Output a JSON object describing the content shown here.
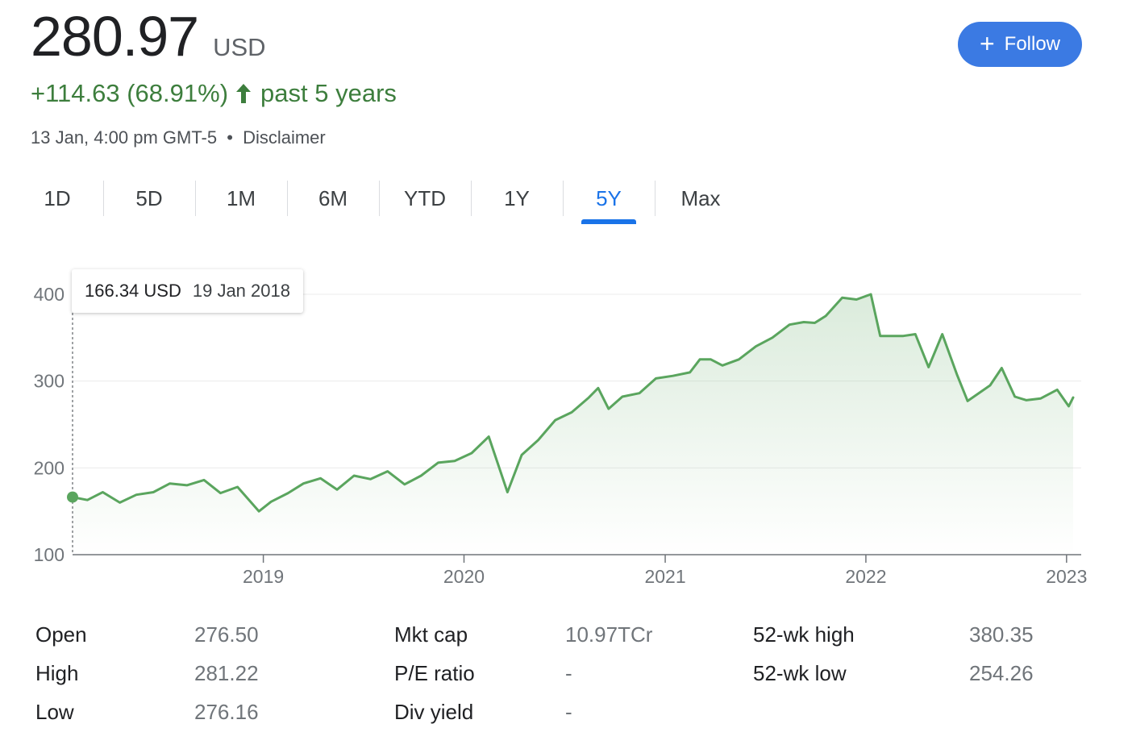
{
  "quote": {
    "price": "280.97",
    "currency": "USD",
    "change": "+114.63 (68.91%)",
    "period": "past 5 years",
    "timestamp": "13 Jan, 4:00 pm GMT-5",
    "separator": "•",
    "disclaimer": "Disclaimer",
    "up_icon": "arrow-up-icon"
  },
  "follow_button": {
    "label": "Follow",
    "icon": "plus-icon"
  },
  "tabs": [
    {
      "label": "1D"
    },
    {
      "label": "5D"
    },
    {
      "label": "1M"
    },
    {
      "label": "6M"
    },
    {
      "label": "YTD"
    },
    {
      "label": "1Y"
    },
    {
      "label": "5Y",
      "active": true
    },
    {
      "label": "Max"
    }
  ],
  "tooltip": {
    "value": "166.34 USD",
    "date": "19 Jan 2018"
  },
  "colors": {
    "line": "#5aa55e",
    "positive": "#3d7e3d",
    "accent": "#1a73e8",
    "button": "#3b7ae3"
  },
  "chart_data": {
    "type": "area",
    "x_unit": "date",
    "xlim": [
      "2018-01-19",
      "2023-01-13"
    ],
    "ylim": [
      100,
      400
    ],
    "yticks": [
      100,
      200,
      300,
      400
    ],
    "ytick_labels": [
      "100",
      "200",
      "300",
      "400"
    ],
    "xticks": [
      "2019-01-01",
      "2020-01-01",
      "2021-01-01",
      "2022-01-01",
      "2023-01-01"
    ],
    "xtick_labels": [
      "2019",
      "2020",
      "2021",
      "2022",
      "2023"
    ],
    "grid": true,
    "highlight_point": {
      "x": "2018-01-19",
      "y": 166.34
    },
    "series": [
      {
        "x": [
          "2018-01-19",
          "2018-02-15",
          "2018-03-15",
          "2018-04-15",
          "2018-05-15",
          "2018-06-15",
          "2018-07-15",
          "2018-08-15",
          "2018-09-15",
          "2018-10-15",
          "2018-11-15",
          "2018-12-24",
          "2019-01-15",
          "2019-02-15",
          "2019-03-15",
          "2019-04-15",
          "2019-05-15",
          "2019-06-15",
          "2019-07-15",
          "2019-08-15",
          "2019-09-15",
          "2019-10-15",
          "2019-11-15",
          "2019-12-15",
          "2020-01-15",
          "2020-02-15",
          "2020-03-20",
          "2020-04-15",
          "2020-05-15",
          "2020-06-15",
          "2020-07-15",
          "2020-08-15",
          "2020-09-01",
          "2020-09-20",
          "2020-10-15",
          "2020-11-15",
          "2020-12-15",
          "2021-01-15",
          "2021-02-15",
          "2021-03-05",
          "2021-03-25",
          "2021-04-15",
          "2021-05-15",
          "2021-06-15",
          "2021-07-15",
          "2021-08-15",
          "2021-09-10",
          "2021-09-30",
          "2021-10-20",
          "2021-11-19",
          "2021-12-15",
          "2022-01-10",
          "2022-01-27",
          "2022-02-20",
          "2022-03-10",
          "2022-04-01",
          "2022-04-25",
          "2022-05-20",
          "2022-06-16",
          "2022-07-05",
          "2022-08-15",
          "2022-09-05",
          "2022-09-29",
          "2022-10-20",
          "2022-11-15",
          "2022-12-15",
          "2023-01-05",
          "2023-01-13"
        ],
        "y": [
          166.34,
          163,
          172,
          160,
          169,
          172,
          182,
          180,
          186,
          171,
          178,
          150,
          161,
          171,
          182,
          188,
          175,
          191,
          187,
          196,
          181,
          191,
          206,
          208,
          217,
          236,
          172,
          215,
          232,
          255,
          264,
          281,
          292,
          268,
          282,
          286,
          303,
          306,
          310,
          325,
          325,
          318,
          325,
          340,
          350,
          365,
          368,
          367,
          375,
          396,
          394,
          400,
          352,
          352,
          352,
          354,
          316,
          354,
          307,
          277,
          295,
          315,
          282,
          278,
          280,
          290,
          271,
          281
        ]
      }
    ]
  },
  "stats": [
    {
      "label": "Open",
      "value": "276.50"
    },
    {
      "label": "High",
      "value": "281.22"
    },
    {
      "label": "Low",
      "value": "276.16"
    },
    {
      "label": "Mkt cap",
      "value": "10.97TCr"
    },
    {
      "label": "P/E ratio",
      "value": "-"
    },
    {
      "label": "Div yield",
      "value": "-"
    },
    {
      "label": "52-wk high",
      "value": "380.35"
    },
    {
      "label": "52-wk low",
      "value": "254.26"
    }
  ]
}
